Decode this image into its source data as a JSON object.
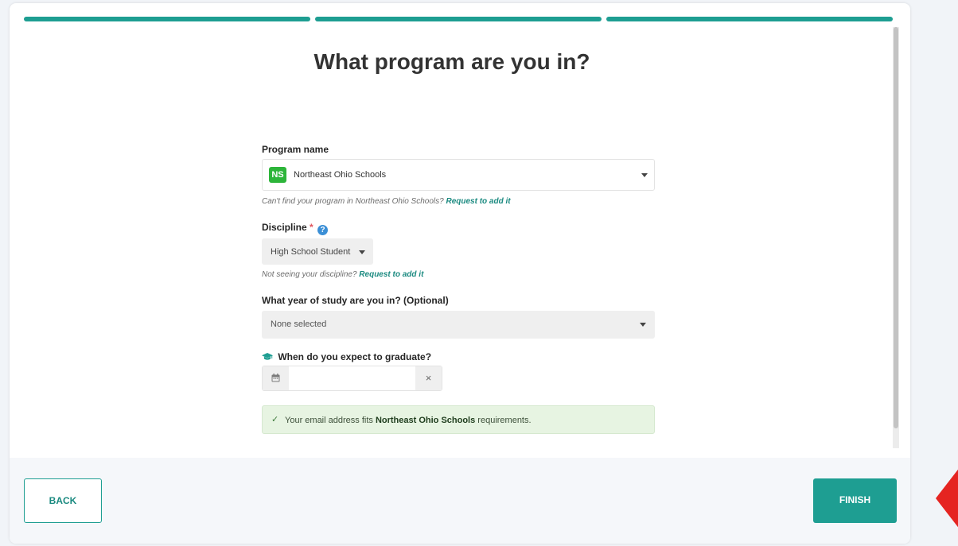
{
  "colors": {
    "accent": "#1e9e92",
    "accent_text": "#1b8a80",
    "badge_green": "#2db53a",
    "help_blue": "#3b8fd6",
    "success_bg": "#e7f4e2",
    "annotation_red": "#e52421"
  },
  "progress": {
    "steps_total": 3,
    "steps_complete": 3
  },
  "page": {
    "title": "What program are you in?"
  },
  "program": {
    "label": "Program name",
    "badge": "NS",
    "value": "Northeast Ohio Schools",
    "hint_text": "Can't find your program in Northeast Ohio Schools?",
    "hint_link": "Request to add it"
  },
  "discipline": {
    "label": "Discipline",
    "required_mark": "*",
    "help_glyph": "?",
    "value": "High School Student",
    "hint_text": "Not seeing your discipline?",
    "hint_link": "Request to add it"
  },
  "year": {
    "label": "What year of study are you in? (Optional)",
    "value": "None selected"
  },
  "graduation": {
    "label": "When do you expect to graduate?",
    "value": "",
    "clear_glyph": "×"
  },
  "alert": {
    "prefix": "Your email address fits",
    "program_name": "Northeast Ohio Schools",
    "suffix": "requirements."
  },
  "footer": {
    "back_label": "BACK",
    "finish_label": "FINISH"
  },
  "icons": {
    "badge": "program-badge",
    "help": "help-circle-icon",
    "graduation": "graduation-cap-icon",
    "calendar": "calendar-icon",
    "check": "checkmark-icon",
    "caret": "caret-down-icon"
  }
}
